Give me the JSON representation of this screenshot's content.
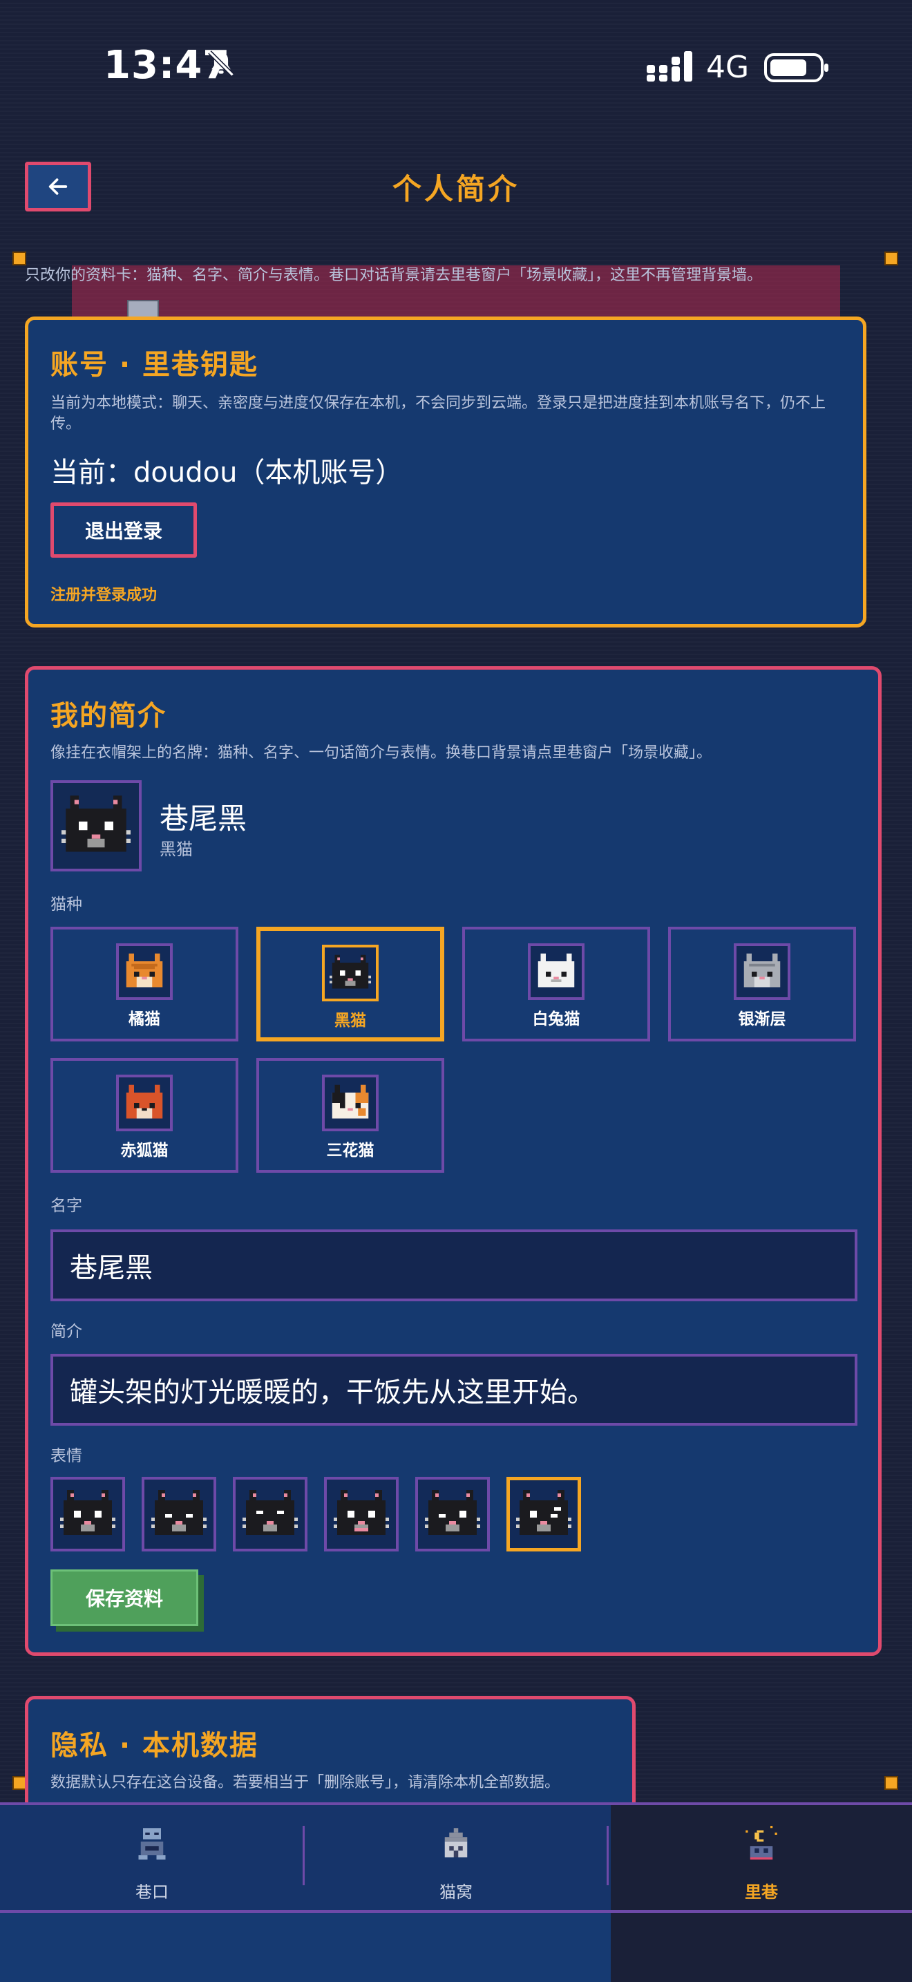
{
  "status": {
    "time": "13:47",
    "network": "4G"
  },
  "header": {
    "title": "个人简介"
  },
  "notice": "只改你的资料卡：猫种、名字、简介与表情。巷口对话背景请去里巷窗户「场景收藏」，这里不再管理背景墙。",
  "account": {
    "title": "账号 · 里巷钥匙",
    "desc": "当前为本地模式：聊天、亲密度与进度仅保存在本机，不会同步到云端。登录只是把进度挂到本机账号名下，仍不上传。",
    "current": "当前：doudou（本机账号）",
    "logout_label": "退出登录",
    "status": "注册并登录成功"
  },
  "profile": {
    "title": "我的简介",
    "desc": "像挂在衣帽架上的名牌：猫种、名字、一句话简介与表情。换巷口背景请点里巷窗户「场景收藏」。",
    "name": "巷尾黑",
    "breed": "黑猫",
    "breed_label": "猫种",
    "breeds": [
      {
        "name": "橘猫",
        "selected": false
      },
      {
        "name": "黑猫",
        "selected": true
      },
      {
        "name": "白兔猫",
        "selected": false
      },
      {
        "name": "银渐层",
        "selected": false
      },
      {
        "name": "赤狐猫",
        "selected": false
      },
      {
        "name": "三花猫",
        "selected": false
      }
    ],
    "name_label": "名字",
    "name_value": "巷尾黑",
    "bio_label": "简介",
    "bio_value": "罐头架的灯光暖暖的，干饭先从这里开始。",
    "expr_label": "表情",
    "expression_selected": 6,
    "save_label": "保存资料"
  },
  "privacy": {
    "title": "隐私 · 本机数据",
    "desc": "数据默认只存在这台设备。若要相当于「删除账号」，请清除本机全部数据。"
  },
  "nav": [
    {
      "label": "巷口",
      "icon": "robot-icon",
      "active": false
    },
    {
      "label": "猫窝",
      "icon": "house-icon",
      "active": false
    },
    {
      "label": "里巷",
      "icon": "moon-night-icon",
      "active": true
    }
  ],
  "colors": {
    "accent": "#f5a623",
    "pink": "#e04a6e",
    "purple": "#6e4aa8",
    "panel": "#15396f",
    "bg": "#1a2038"
  }
}
